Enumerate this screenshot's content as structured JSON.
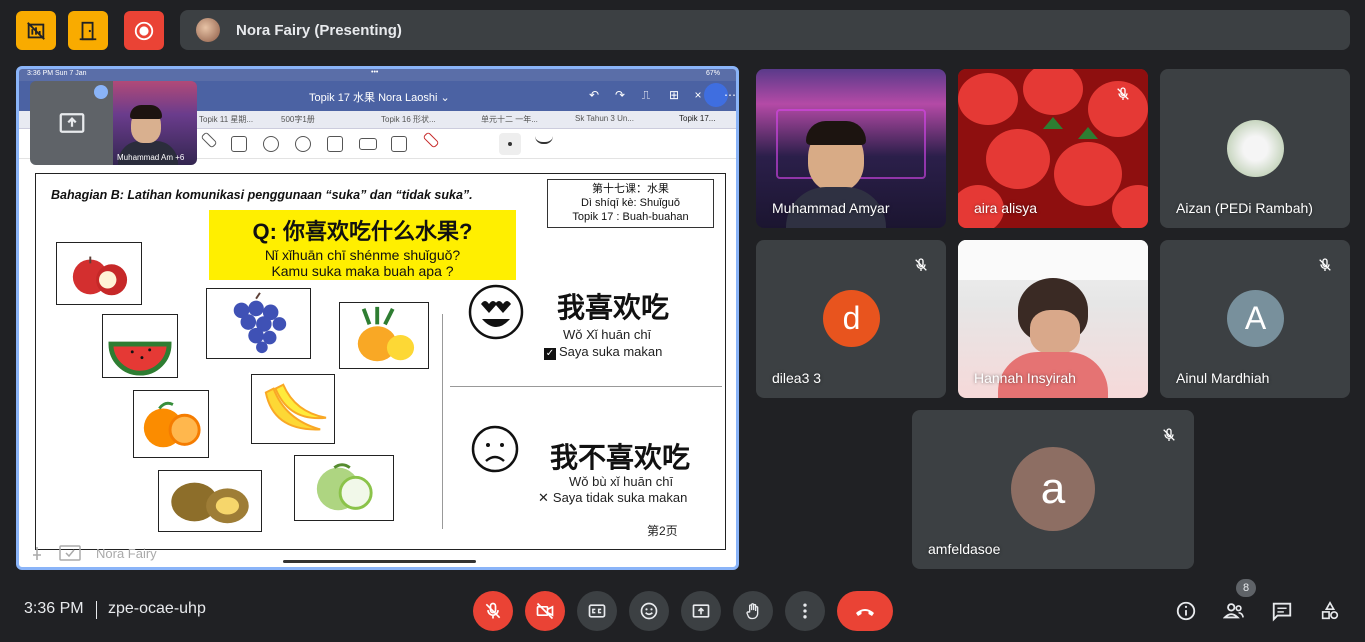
{
  "meeting": {
    "presenting_banner": "Nora Fairy (Presenting)",
    "time": "3:36 PM",
    "code": "zpe-ocae-uhp",
    "participant_count": "8"
  },
  "presentation": {
    "status_time": "3:36 PM  Sun 7 Jan",
    "battery": "67%",
    "doc_title": "Topik 17 水果  Nora Laoshi ⌄",
    "tabs": [
      "Topik 11 星期...",
      "500字1册",
      "Topik 16 形状...",
      "单元十二 一年...",
      "Sk Tahun 3 Un...",
      "Topik 17..."
    ],
    "pip_label": "Muhammad Am +6",
    "presenter_overlay_name": "Nora Fairy",
    "sheet": {
      "heading": "Bahagian B: Latihan komunikasi penggunaan “suka” dan “tidak suka”.",
      "lesson_cn": "第十七课：水果",
      "lesson_pin": "Dì shíqī kè: Shuǐguǒ",
      "lesson_malay": "Topik  17 : Buah-buahan",
      "question_cn": "Q: 你喜欢吃什么水果?",
      "question_pin": "Nǐ xǐhuān chī shénme shuǐguǒ?",
      "question_malay": "Kamu suka maka buah apa ?",
      "like_cn": "我喜欢吃",
      "like_pin": "Wǒ Xǐ huān chī",
      "like_malay": "Saya suka makan",
      "dislike_cn": "我不喜欢吃",
      "dislike_pin": "Wǒ bù xǐ huān chī",
      "dislike_malay": "Saya tidak suka makan",
      "page": "第2页"
    }
  },
  "participants": [
    {
      "name": "Muhammad Amyar",
      "muted": false
    },
    {
      "name": "aira alisya",
      "muted": true
    },
    {
      "name": "Aizan (PEDi Rambah)",
      "muted": false
    },
    {
      "name": "dilea3 3",
      "muted": true,
      "initial": "d",
      "color": "#e8541e"
    },
    {
      "name": "Hannah Insyirah",
      "muted": false
    },
    {
      "name": "Ainul Mardhiah",
      "muted": true,
      "initial": "A",
      "color": "#78909c"
    },
    {
      "name": "amfeldasoe",
      "muted": true,
      "initial": "a",
      "color": "#8d6e63"
    }
  ],
  "colors": {
    "accent": "#8ab4f8",
    "danger": "#ea4335",
    "top_button": "#f9ab00"
  },
  "icons": {
    "top": [
      "hide-presentation-icon",
      "door-exit-icon",
      "record-icon"
    ],
    "controls": [
      "mic-off-icon",
      "camera-off-icon",
      "captions-icon",
      "emoji-icon",
      "present-icon",
      "raise-hand-icon",
      "more-options-icon",
      "end-call-icon"
    ],
    "right": [
      "info-icon",
      "people-icon",
      "chat-icon",
      "activities-icon"
    ]
  }
}
